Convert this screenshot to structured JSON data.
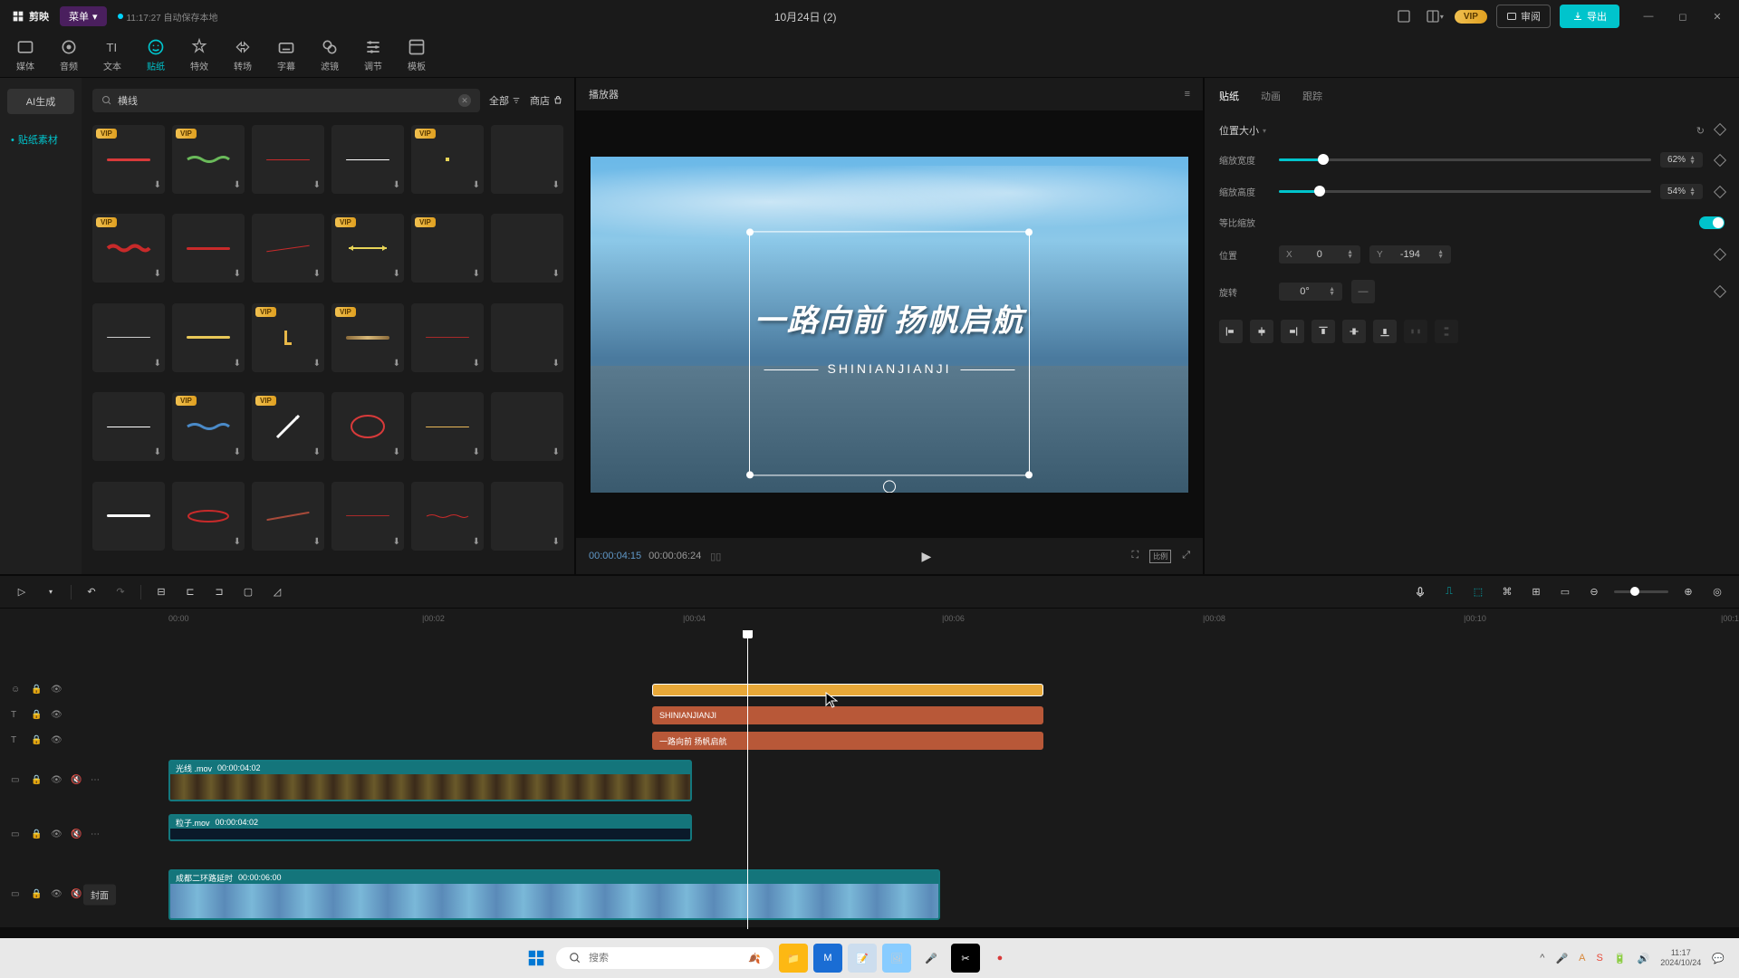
{
  "title_bar": {
    "app_name": "剪映",
    "menu": "菜单",
    "autosave": "11:17:27 自动保存本地",
    "project_name": "10月24日 (2)",
    "vip": "VIP",
    "review": "审阅",
    "export": "导出"
  },
  "top_tabs": {
    "media": "媒体",
    "audio": "音频",
    "text": "文本",
    "sticker": "贴纸",
    "effect": "特效",
    "transition": "转场",
    "subtitle": "字幕",
    "filter": "滤镜",
    "adjust": "调节",
    "template": "模板"
  },
  "sidebar": {
    "ai_gen": "AI生成",
    "sticker_material": "贴纸素材"
  },
  "search": {
    "value": "横线",
    "all": "全部",
    "shop": "商店"
  },
  "stickers_vip": "VIP",
  "preview": {
    "title": "播放器",
    "time_current": "00:00:04:15",
    "time_total": "00:00:06:24",
    "title_text": "一路向前 扬帆启航",
    "subtitle_text": "SHINIANJIANJI"
  },
  "props": {
    "tab_sticker": "贴纸",
    "tab_anim": "动画",
    "tab_track": "跟踪",
    "section": "位置大小",
    "scale_w_label": "缩放宽度",
    "scale_w_val": "62%",
    "scale_h_label": "缩放高度",
    "scale_h_val": "54%",
    "ratio_label": "等比缩放",
    "pos_label": "位置",
    "x_label": "X",
    "x_val": "0",
    "y_label": "Y",
    "y_val": "-194",
    "rot_label": "旋转",
    "rot_val": "0°"
  },
  "timeline": {
    "marks": [
      "00:00",
      "|00:02",
      "|00:04",
      "|00:06",
      "|00:08",
      "|00:10",
      "|00:1"
    ],
    "text1": "SHINIANJIANJI",
    "text2": "一路向前 扬帆启航",
    "clip1_name": "光线 .mov",
    "clip1_dur": "00:00:04:02",
    "clip2_name": "粒子.mov",
    "clip2_dur": "00:00:04:02",
    "main_name": "成都二环路延时",
    "main_dur": "00:00:06:00",
    "cover": "封面"
  },
  "taskbar": {
    "search_placeholder": "搜索",
    "time": "11:17",
    "date": "2024/10/24"
  }
}
